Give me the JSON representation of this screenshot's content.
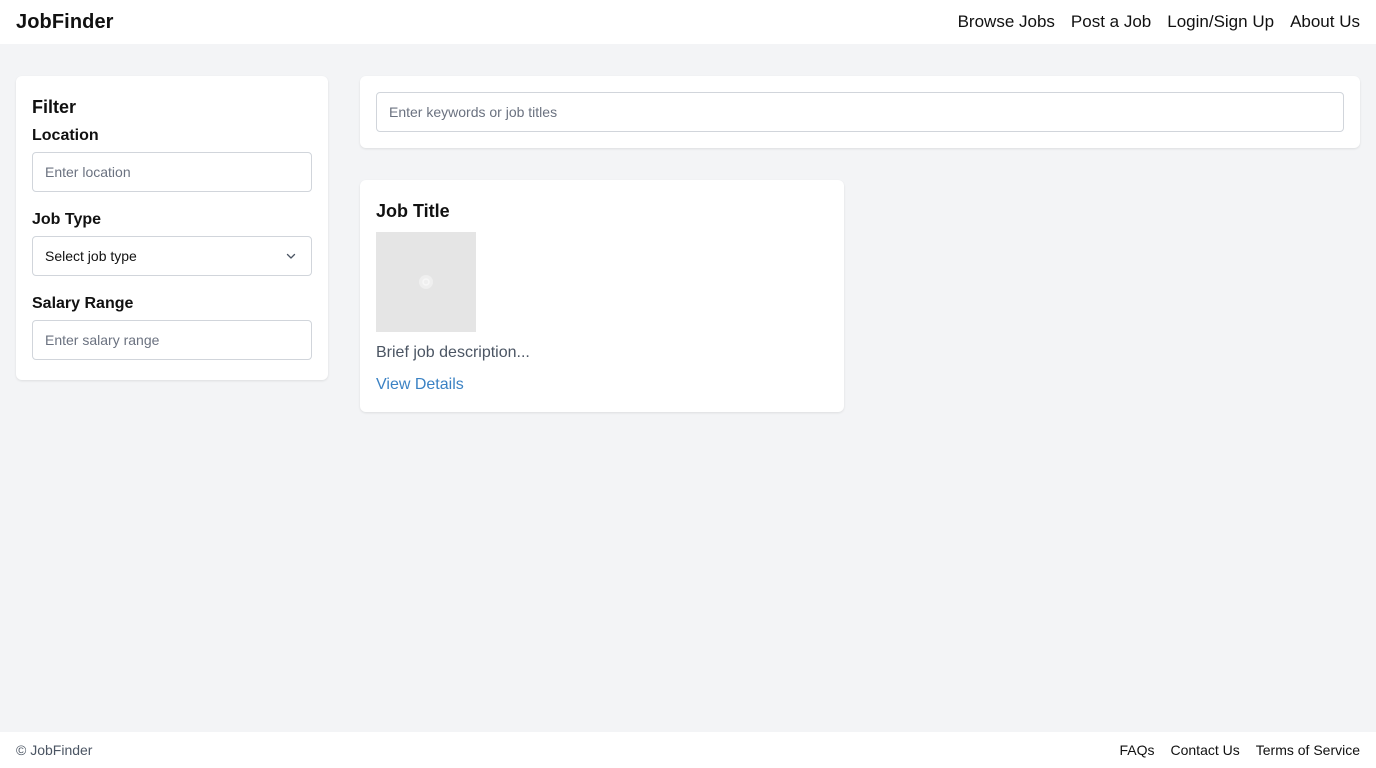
{
  "header": {
    "brand": "JobFinder",
    "nav": [
      {
        "label": "Browse Jobs"
      },
      {
        "label": "Post a Job"
      },
      {
        "label": "Login/Sign Up"
      },
      {
        "label": "About Us"
      }
    ]
  },
  "filter": {
    "title": "Filter",
    "location": {
      "label": "Location",
      "placeholder": "Enter location"
    },
    "job_type": {
      "label": "Job Type",
      "selected": "Select job type",
      "icon": "chevron-down-icon"
    },
    "salary": {
      "label": "Salary Range",
      "placeholder": "Enter salary range"
    }
  },
  "search": {
    "placeholder": "Enter keywords or job titles"
  },
  "jobs": [
    {
      "title": "Job Title",
      "image_icon": "image-placeholder-icon",
      "description": "Brief job description...",
      "link_label": "View Details"
    }
  ],
  "footer": {
    "copyright": "© JobFinder",
    "links": [
      {
        "label": "FAQs"
      },
      {
        "label": "Contact Us"
      },
      {
        "label": "Terms of Service"
      }
    ]
  },
  "colors": {
    "page_bg": "#f3f4f6",
    "card_bg": "#ffffff",
    "link": "#3b82c4",
    "border": "#d1d5db",
    "thumb_bg": "#e5e5e5"
  }
}
